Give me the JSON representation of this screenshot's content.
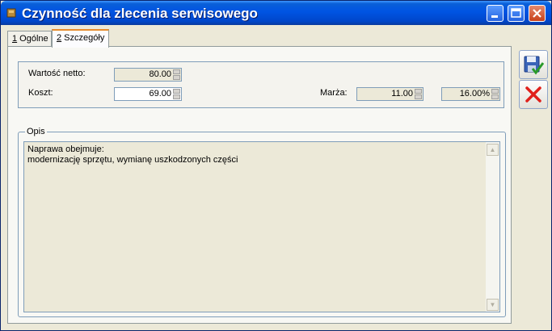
{
  "window": {
    "title": "Czynność dla zlecenia serwisowego"
  },
  "tabs": [
    {
      "key": "1",
      "label": " Ogólne"
    },
    {
      "key": "2",
      "label": " Szczegóły"
    }
  ],
  "fields": {
    "wartosc_netto_label": "Wartość netto:",
    "wartosc_netto_value": "80.00",
    "koszt_label": "Koszt:",
    "koszt_value": "69.00",
    "marza_label": "Marża:",
    "marza_value": "11.00",
    "marza_percent": "16.00%"
  },
  "opis": {
    "legend": "Opis",
    "lines": [
      "Naprawa obejmuje:",
      "modernizację sprzętu, wymianę uszkodzonych części"
    ]
  },
  "icons": {
    "save": "save-icon",
    "cancel": "cancel-icon",
    "app": "app-icon"
  },
  "colors": {
    "titlebar": "#0054e3",
    "active_tab_accent": "#e68b2c",
    "cancel_red": "#e0201b",
    "save_green": "#2a9a2a"
  }
}
